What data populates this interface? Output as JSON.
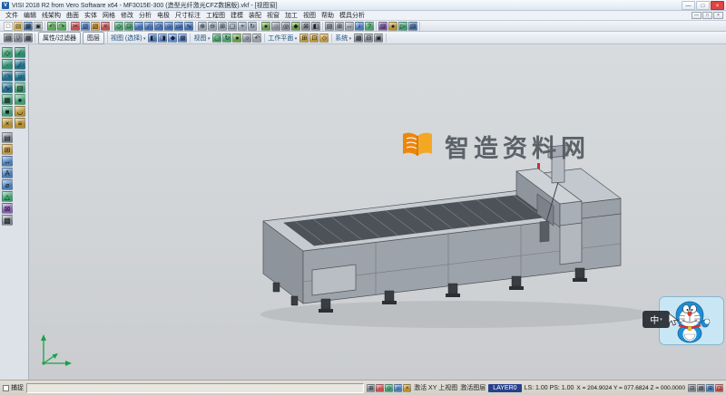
{
  "titlebar": {
    "app_icon": "V",
    "title": "VISI 2018 R2 from Vero Software x64  -  MF3015E-300 (造型光纤激光CFZ数据版).vkf - [视图窗]",
    "buttons": {
      "min": "—",
      "max": "□",
      "close": "×"
    }
  },
  "menubar": {
    "items": [
      "文件",
      "编辑",
      "线架构",
      "曲面",
      "实体",
      "网格",
      "修改",
      "分析",
      "电极",
      "尺寸标注",
      "工程图",
      "建模",
      "装配",
      "视窗",
      "加工",
      "视图",
      "帮助",
      "模具分析"
    ],
    "mdi": {
      "min": "—",
      "restore": "□",
      "close": "×"
    }
  },
  "toolbar1": {
    "groups": [
      [
        {
          "n": "new",
          "g": "□",
          "c": "#fdfdfd"
        },
        {
          "n": "open",
          "g": "▤",
          "c": "#f0c24b"
        },
        {
          "n": "save",
          "g": "▦",
          "c": "#4a7ebb"
        },
        {
          "n": "print",
          "g": "▣",
          "c": "#c7cdd4"
        }
      ],
      [
        {
          "n": "undo",
          "g": "↶",
          "c": "#57a957"
        },
        {
          "n": "redo",
          "g": "↷",
          "c": "#57a957"
        }
      ],
      [
        {
          "n": "cut",
          "g": "✂",
          "c": "#c65050"
        },
        {
          "n": "copy",
          "g": "▥",
          "c": "#5b8dd9"
        },
        {
          "n": "paste",
          "g": "▧",
          "c": "#e0a63c"
        },
        {
          "n": "delete",
          "g": "×",
          "c": "#c65050"
        }
      ],
      [
        {
          "n": "select",
          "g": "◇",
          "c": "#49a36b"
        },
        {
          "n": "select-window",
          "g": "⊡",
          "c": "#49a36b"
        },
        {
          "n": "point",
          "g": "∙",
          "c": "#3f6fb5"
        },
        {
          "n": "line",
          "g": "∕",
          "c": "#3f6fb5"
        },
        {
          "n": "arc",
          "g": "◠",
          "c": "#3f6fb5"
        },
        {
          "n": "circle",
          "g": "○",
          "c": "#3f6fb5"
        },
        {
          "n": "rectangle",
          "g": "▭",
          "c": "#3f6fb5"
        },
        {
          "n": "spline",
          "g": "∿",
          "c": "#3f6fb5"
        }
      ],
      [
        {
          "n": "zoom-in",
          "g": "⊕",
          "c": "#9aa6b5"
        },
        {
          "n": "zoom-out",
          "g": "⊖",
          "c": "#9aa6b5"
        },
        {
          "n": "zoom-window",
          "g": "⊞",
          "c": "#9aa6b5"
        },
        {
          "n": "zoom-fit",
          "g": "▢",
          "c": "#9aa6b5"
        },
        {
          "n": "pan",
          "g": "+",
          "c": "#9aa6b5"
        },
        {
          "n": "rotate-view",
          "g": "↻",
          "c": "#9aa6b5"
        }
      ],
      [
        {
          "n": "shaded",
          "g": "●",
          "c": "#6a9f46"
        },
        {
          "n": "wireframe",
          "g": "◌",
          "c": "#8a9099"
        },
        {
          "n": "hidden-line",
          "g": "◎",
          "c": "#8a9099"
        },
        {
          "n": "isometric",
          "g": "◆",
          "c": "#6a9f46"
        },
        {
          "n": "views",
          "g": "⊠",
          "c": "#8a9099"
        },
        {
          "n": "section",
          "g": "◧",
          "c": "#8a9099"
        }
      ],
      [
        {
          "n": "layers",
          "g": "▤",
          "c": "#9aa0a8"
        },
        {
          "n": "grid",
          "g": "⊞",
          "c": "#9aa0a8"
        },
        {
          "n": "measure",
          "g": "↔",
          "c": "#9aa0a8"
        },
        {
          "n": "info",
          "g": "i",
          "c": "#4a7ebb"
        },
        {
          "n": "help",
          "g": "?",
          "c": "#49a36b"
        }
      ],
      [
        {
          "n": "material",
          "g": "▨",
          "c": "#8a5fb5"
        },
        {
          "n": "render",
          "g": "●",
          "c": "#b8912f"
        },
        {
          "n": "animate",
          "g": "▷",
          "c": "#3da06f"
        },
        {
          "n": "report",
          "g": "▤",
          "c": "#4a7ebb"
        }
      ]
    ]
  },
  "toolbar2": {
    "lead_icons": [
      {
        "n": "properties",
        "g": "▤",
        "c": "#7f8790"
      },
      {
        "n": "filter",
        "g": "▽",
        "c": "#7f8790"
      },
      {
        "n": "layer-manager",
        "g": "▦",
        "c": "#7f8790"
      }
    ],
    "tabs": [
      "属性/过滤器",
      "图层"
    ],
    "groups": [
      {
        "label": "视图 (选择)",
        "icons": [
          {
            "n": "view-front",
            "g": "◧",
            "c": "#5b8dd9"
          },
          {
            "n": "view-top",
            "g": "◨",
            "c": "#5b8dd9"
          },
          {
            "n": "view-iso",
            "g": "◆",
            "c": "#5b8dd9"
          },
          {
            "n": "view-named",
            "g": "▦",
            "c": "#5b8dd9"
          }
        ]
      },
      {
        "label": "视图",
        "icons": [
          {
            "n": "zoom-all",
            "g": "▢",
            "c": "#49a36b"
          },
          {
            "n": "refresh",
            "g": "↻",
            "c": "#49a36b"
          },
          {
            "n": "shade-mode",
            "g": "●",
            "c": "#6a9f46"
          },
          {
            "n": "wire-mode",
            "g": "○",
            "c": "#8a9099"
          },
          {
            "n": "previous-view",
            "g": "↶",
            "c": "#9aa0a8"
          }
        ]
      },
      {
        "label": "工作平面",
        "icons": [
          {
            "n": "workplane-xy",
            "g": "⊞",
            "c": "#c79b3d"
          },
          {
            "n": "workplane-new",
            "g": "⊡",
            "c": "#c79b3d"
          },
          {
            "n": "workplane-align",
            "g": "◇",
            "c": "#c79b3d"
          }
        ]
      },
      {
        "label": "系统",
        "icons": [
          {
            "n": "settings",
            "g": "▩",
            "c": "#8a9099"
          },
          {
            "n": "calculator",
            "g": "⊟",
            "c": "#8a9099"
          },
          {
            "n": "macro",
            "g": "▣",
            "c": "#8a9099"
          }
        ]
      }
    ]
  },
  "left_rail": {
    "grid": [
      {
        "n": "select-tool",
        "g": "◇",
        "c": "#3da06f"
      },
      {
        "n": "wireframe-tool",
        "g": "∕",
        "c": "#2c8c6e"
      },
      {
        "n": "point-tool",
        "g": "∙",
        "c": "#2c8c6e"
      },
      {
        "n": "line-tool",
        "g": "∕",
        "c": "#1f6f8b"
      },
      {
        "n": "arc-tool",
        "g": "◠",
        "c": "#1f6f8b"
      },
      {
        "n": "circle-tool",
        "g": "○",
        "c": "#1f6f8b"
      },
      {
        "n": "curve-tool",
        "g": "∿",
        "c": "#1f6f8b"
      },
      {
        "n": "surface-tool",
        "g": "▧",
        "c": "#3da06f"
      },
      {
        "n": "solid-tool",
        "g": "▦",
        "c": "#3da06f"
      },
      {
        "n": "sphere-tool",
        "g": "●",
        "c": "#3da06f"
      },
      {
        "n": "block-tool",
        "g": "■",
        "c": "#3da06f"
      },
      {
        "n": "fillet-tool",
        "g": "◡",
        "c": "#b8912f"
      },
      {
        "n": "trim-tool",
        "g": "×",
        "c": "#b8912f"
      },
      {
        "n": "offset-tool",
        "g": "≡",
        "c": "#b8912f"
      }
    ],
    "list": [
      {
        "n": "layers-panel",
        "g": "▤",
        "c": "#7f8790"
      },
      {
        "n": "workplane-panel",
        "g": "⊞",
        "c": "#c79b3d"
      },
      {
        "n": "dimension-tool",
        "g": "↔",
        "c": "#4a7ebb"
      },
      {
        "n": "text-tool",
        "g": "A",
        "c": "#4a7ebb"
      },
      {
        "n": "diameter-tool",
        "g": "⌀",
        "c": "#4a7ebb"
      },
      {
        "n": "analyze-tool",
        "g": "△",
        "c": "#3da06f"
      },
      {
        "n": "machining-tool",
        "g": "⊠",
        "c": "#8a5fb5"
      },
      {
        "n": "options-tool",
        "g": "▩",
        "c": "#7f8790"
      }
    ]
  },
  "viewport": {
    "watermark": {
      "text": "智造资料网",
      "logo_color": "#ef8200",
      "text_color": "#565c63"
    },
    "ime_badge": "中"
  },
  "statusbar": {
    "snap_label": "捕捉",
    "active_view": "激活 XY 上视图",
    "view_mode": "激活图层",
    "layer": "LAYER0",
    "scale": "LS: 1.00 PS: 1.00",
    "coords": "X = 204.9024 Y = 077.6824 Z = 000.0000",
    "left_icons": [
      {
        "n": "snap-grid",
        "g": "⊞",
        "c": "#7f8790"
      },
      {
        "n": "snap-endpoint",
        "g": "∙",
        "c": "#c65050"
      },
      {
        "n": "snap-midpoint",
        "g": "◇",
        "c": "#3da06f"
      },
      {
        "n": "snap-center",
        "g": "○",
        "c": "#4a7ebb"
      },
      {
        "n": "snap-intersection",
        "g": "×",
        "c": "#b8912f"
      }
    ],
    "right_icons": [
      {
        "n": "coord-mode",
        "g": "⊡",
        "c": "#7f8790"
      },
      {
        "n": "units",
        "g": "▤",
        "c": "#7f8790"
      },
      {
        "n": "grid-toggle",
        "g": "⊞",
        "c": "#4a7ebb"
      },
      {
        "n": "fullscreen",
        "g": "▢",
        "c": "#c65050"
      }
    ]
  }
}
